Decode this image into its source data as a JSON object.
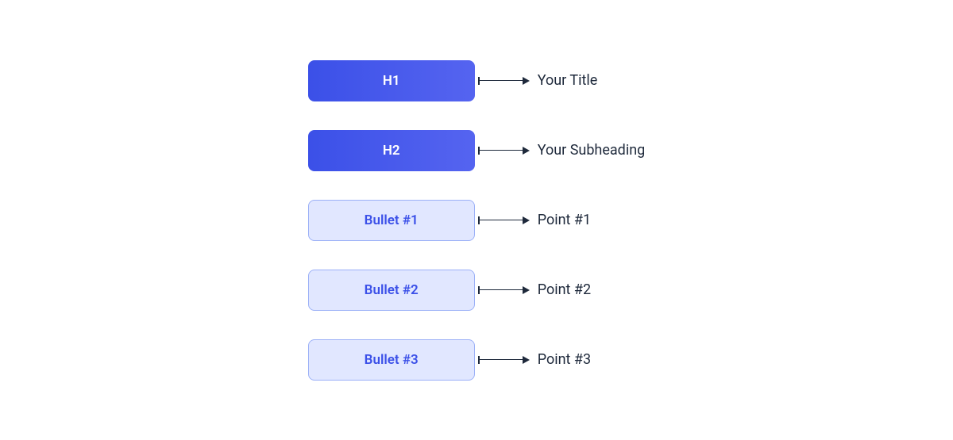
{
  "rows": [
    {
      "tag": "H1",
      "style": "primary",
      "label": "Your Title"
    },
    {
      "tag": "H2",
      "style": "primary",
      "label": "Your Subheading"
    },
    {
      "tag": "Bullet #1",
      "style": "secondary",
      "label": "Point #1"
    },
    {
      "tag": "Bullet #2",
      "style": "secondary",
      "label": "Point #2"
    },
    {
      "tag": "Bullet #3",
      "style": "secondary",
      "label": "Point #3"
    }
  ]
}
